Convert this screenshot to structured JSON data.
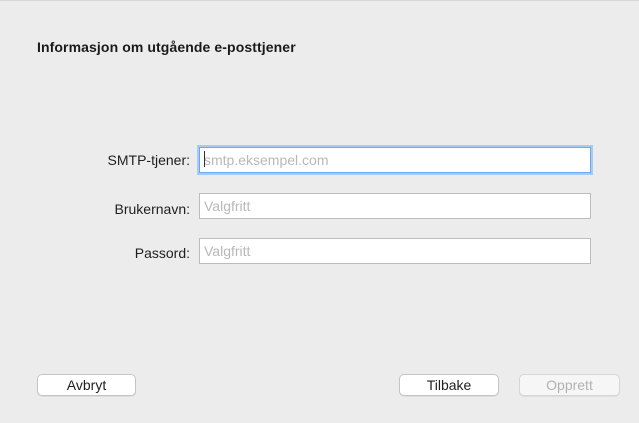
{
  "dialog": {
    "title": "Informasjon om utgående e-posttjener"
  },
  "form": {
    "smtp": {
      "label": "SMTP-tjener:",
      "value": "",
      "placeholder": "smtp.eksempel.com"
    },
    "username": {
      "label": "Brukernavn:",
      "value": "",
      "placeholder": "Valgfritt"
    },
    "password": {
      "label": "Passord:",
      "value": "",
      "placeholder": "Valgfritt"
    }
  },
  "buttons": {
    "cancel": "Avbryt",
    "back": "Tilbake",
    "create": "Opprett"
  },
  "colors": {
    "background": "#ececec",
    "focus_ring": "#a8cbf5",
    "disabled_text": "#b2b2b2"
  }
}
